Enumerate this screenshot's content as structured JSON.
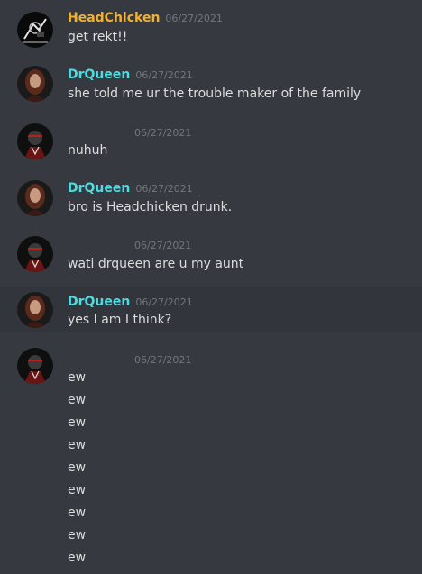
{
  "colors": {
    "background": "#36393f",
    "highlight_row": "#32353b",
    "text": "#dcddde",
    "timestamp": "#72767d",
    "headchicken": "#f0b232",
    "drqueen": "#4fdbe0",
    "third_user": "#8a2a2a"
  },
  "messages": [
    {
      "author": "HeadChicken",
      "timestamp": "06/27/2021",
      "lines": [
        "get rekt!!"
      ]
    },
    {
      "author": "DrQueen",
      "timestamp": "06/27/2021",
      "lines": [
        "she told me ur the trouble maker of the family"
      ]
    },
    {
      "author": "",
      "timestamp": "06/27/2021",
      "lines": [
        "nuhuh"
      ]
    },
    {
      "author": "DrQueen",
      "timestamp": "06/27/2021",
      "lines": [
        "bro is Headchicken drunk."
      ]
    },
    {
      "author": "",
      "timestamp": "06/27/2021",
      "lines": [
        "wati drqueen are u my aunt"
      ]
    },
    {
      "author": "DrQueen",
      "timestamp": "06/27/2021",
      "lines": [
        "yes I am I think?"
      ]
    },
    {
      "author": "",
      "timestamp": "06/27/2021",
      "lines": [
        "ew",
        "ew",
        "ew",
        "ew",
        "ew",
        "ew",
        "ew",
        "ew",
        "ew"
      ]
    }
  ]
}
